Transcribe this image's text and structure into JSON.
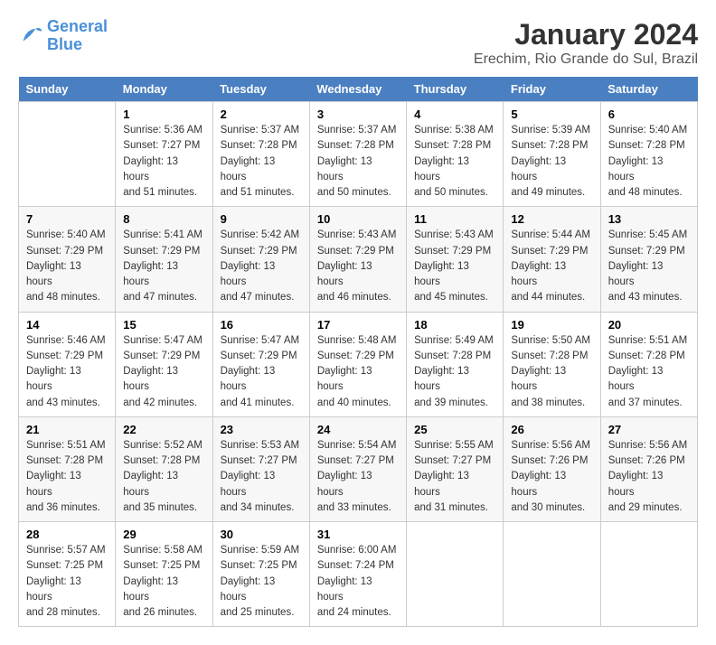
{
  "header": {
    "logo_line1": "General",
    "logo_line2": "Blue",
    "main_title": "January 2024",
    "subtitle": "Erechim, Rio Grande do Sul, Brazil"
  },
  "days_of_week": [
    "Sunday",
    "Monday",
    "Tuesday",
    "Wednesday",
    "Thursday",
    "Friday",
    "Saturday"
  ],
  "weeks": [
    [
      {
        "day": "",
        "info": ""
      },
      {
        "day": "1",
        "info": "Sunrise: 5:36 AM\nSunset: 7:27 PM\nDaylight: 13 hours\nand 51 minutes."
      },
      {
        "day": "2",
        "info": "Sunrise: 5:37 AM\nSunset: 7:28 PM\nDaylight: 13 hours\nand 51 minutes."
      },
      {
        "day": "3",
        "info": "Sunrise: 5:37 AM\nSunset: 7:28 PM\nDaylight: 13 hours\nand 50 minutes."
      },
      {
        "day": "4",
        "info": "Sunrise: 5:38 AM\nSunset: 7:28 PM\nDaylight: 13 hours\nand 50 minutes."
      },
      {
        "day": "5",
        "info": "Sunrise: 5:39 AM\nSunset: 7:28 PM\nDaylight: 13 hours\nand 49 minutes."
      },
      {
        "day": "6",
        "info": "Sunrise: 5:40 AM\nSunset: 7:28 PM\nDaylight: 13 hours\nand 48 minutes."
      }
    ],
    [
      {
        "day": "7",
        "info": "Sunrise: 5:40 AM\nSunset: 7:29 PM\nDaylight: 13 hours\nand 48 minutes."
      },
      {
        "day": "8",
        "info": "Sunrise: 5:41 AM\nSunset: 7:29 PM\nDaylight: 13 hours\nand 47 minutes."
      },
      {
        "day": "9",
        "info": "Sunrise: 5:42 AM\nSunset: 7:29 PM\nDaylight: 13 hours\nand 47 minutes."
      },
      {
        "day": "10",
        "info": "Sunrise: 5:43 AM\nSunset: 7:29 PM\nDaylight: 13 hours\nand 46 minutes."
      },
      {
        "day": "11",
        "info": "Sunrise: 5:43 AM\nSunset: 7:29 PM\nDaylight: 13 hours\nand 45 minutes."
      },
      {
        "day": "12",
        "info": "Sunrise: 5:44 AM\nSunset: 7:29 PM\nDaylight: 13 hours\nand 44 minutes."
      },
      {
        "day": "13",
        "info": "Sunrise: 5:45 AM\nSunset: 7:29 PM\nDaylight: 13 hours\nand 43 minutes."
      }
    ],
    [
      {
        "day": "14",
        "info": "Sunrise: 5:46 AM\nSunset: 7:29 PM\nDaylight: 13 hours\nand 43 minutes."
      },
      {
        "day": "15",
        "info": "Sunrise: 5:47 AM\nSunset: 7:29 PM\nDaylight: 13 hours\nand 42 minutes."
      },
      {
        "day": "16",
        "info": "Sunrise: 5:47 AM\nSunset: 7:29 PM\nDaylight: 13 hours\nand 41 minutes."
      },
      {
        "day": "17",
        "info": "Sunrise: 5:48 AM\nSunset: 7:29 PM\nDaylight: 13 hours\nand 40 minutes."
      },
      {
        "day": "18",
        "info": "Sunrise: 5:49 AM\nSunset: 7:28 PM\nDaylight: 13 hours\nand 39 minutes."
      },
      {
        "day": "19",
        "info": "Sunrise: 5:50 AM\nSunset: 7:28 PM\nDaylight: 13 hours\nand 38 minutes."
      },
      {
        "day": "20",
        "info": "Sunrise: 5:51 AM\nSunset: 7:28 PM\nDaylight: 13 hours\nand 37 minutes."
      }
    ],
    [
      {
        "day": "21",
        "info": "Sunrise: 5:51 AM\nSunset: 7:28 PM\nDaylight: 13 hours\nand 36 minutes."
      },
      {
        "day": "22",
        "info": "Sunrise: 5:52 AM\nSunset: 7:28 PM\nDaylight: 13 hours\nand 35 minutes."
      },
      {
        "day": "23",
        "info": "Sunrise: 5:53 AM\nSunset: 7:27 PM\nDaylight: 13 hours\nand 34 minutes."
      },
      {
        "day": "24",
        "info": "Sunrise: 5:54 AM\nSunset: 7:27 PM\nDaylight: 13 hours\nand 33 minutes."
      },
      {
        "day": "25",
        "info": "Sunrise: 5:55 AM\nSunset: 7:27 PM\nDaylight: 13 hours\nand 31 minutes."
      },
      {
        "day": "26",
        "info": "Sunrise: 5:56 AM\nSunset: 7:26 PM\nDaylight: 13 hours\nand 30 minutes."
      },
      {
        "day": "27",
        "info": "Sunrise: 5:56 AM\nSunset: 7:26 PM\nDaylight: 13 hours\nand 29 minutes."
      }
    ],
    [
      {
        "day": "28",
        "info": "Sunrise: 5:57 AM\nSunset: 7:25 PM\nDaylight: 13 hours\nand 28 minutes."
      },
      {
        "day": "29",
        "info": "Sunrise: 5:58 AM\nSunset: 7:25 PM\nDaylight: 13 hours\nand 26 minutes."
      },
      {
        "day": "30",
        "info": "Sunrise: 5:59 AM\nSunset: 7:25 PM\nDaylight: 13 hours\nand 25 minutes."
      },
      {
        "day": "31",
        "info": "Sunrise: 6:00 AM\nSunset: 7:24 PM\nDaylight: 13 hours\nand 24 minutes."
      },
      {
        "day": "",
        "info": ""
      },
      {
        "day": "",
        "info": ""
      },
      {
        "day": "",
        "info": ""
      }
    ]
  ]
}
